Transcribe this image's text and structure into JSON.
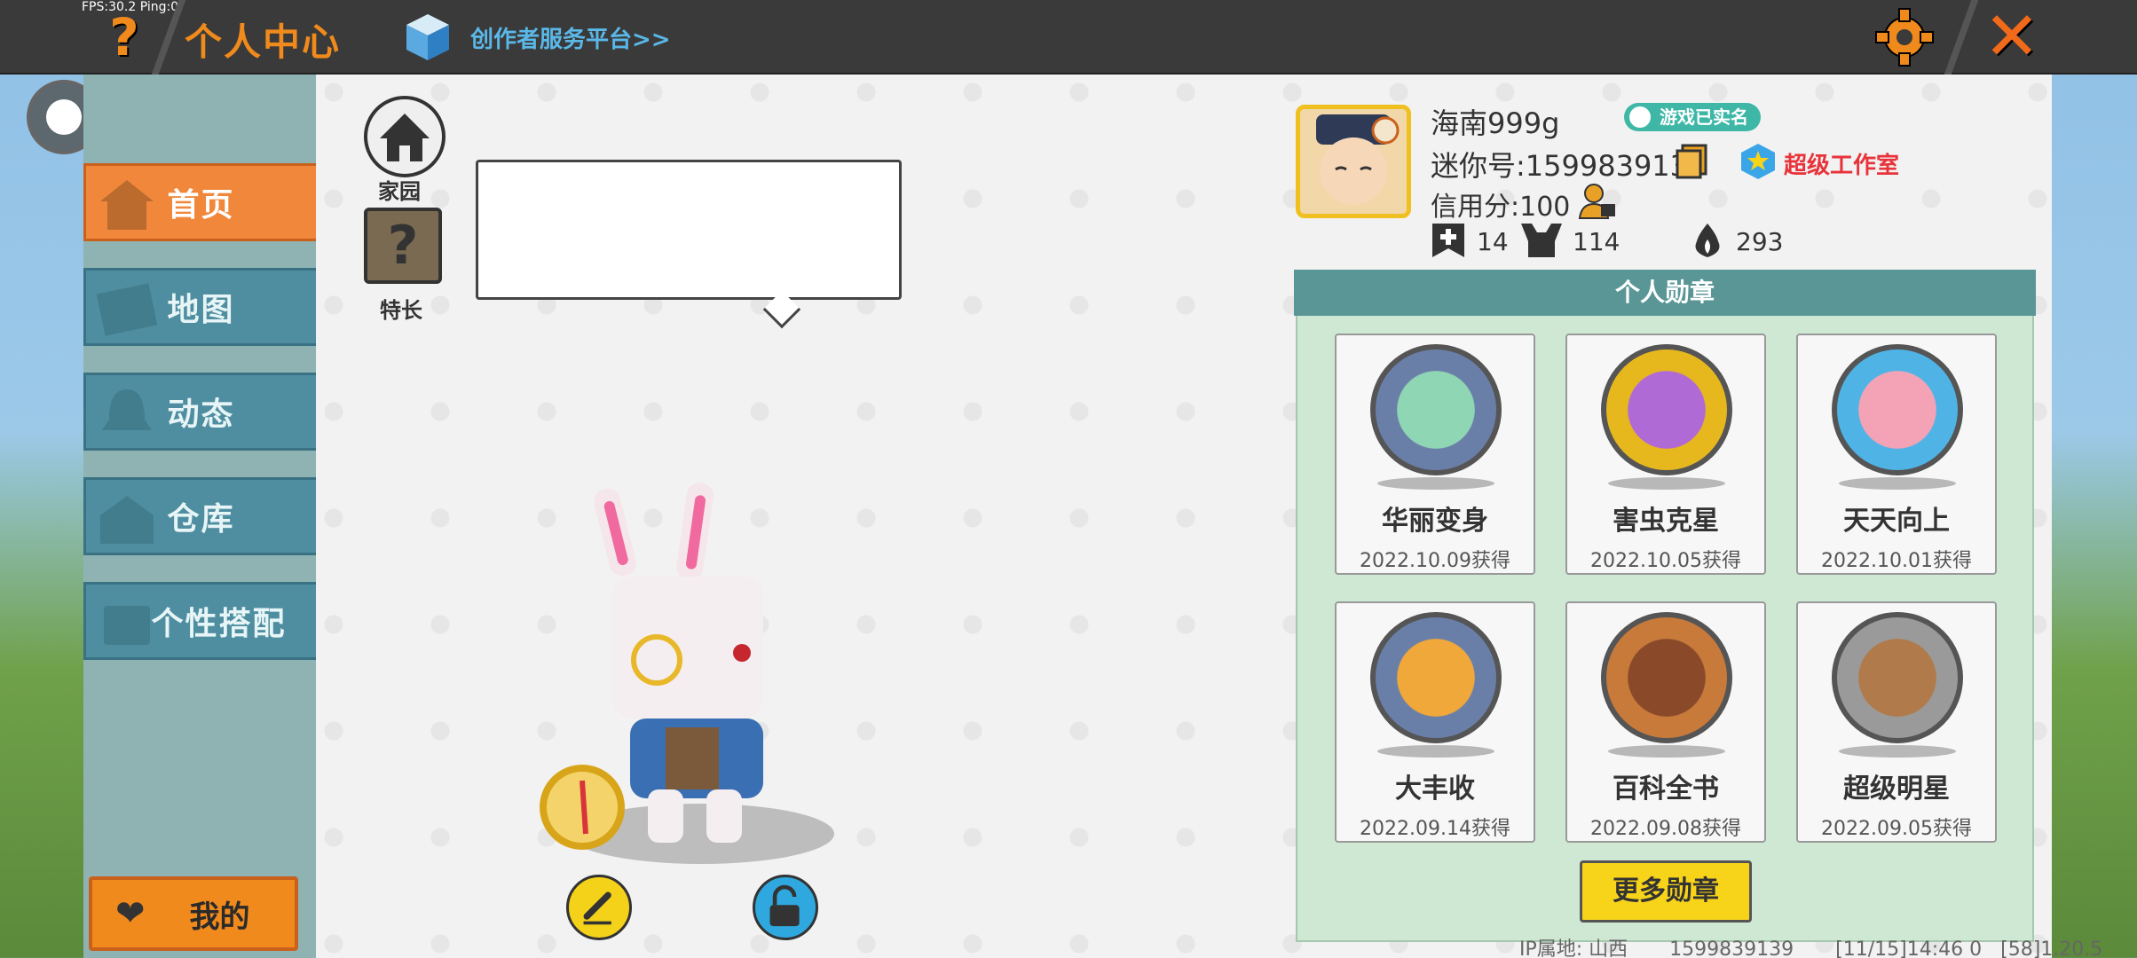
{
  "debug": {
    "fps": "FPS:30.2  Ping:0"
  },
  "header": {
    "title": "个人中心",
    "creator_link": "创作者服务平台>>",
    "help_icon": "question-icon",
    "settings_icon": "gear-icon",
    "close_icon": "close-icon"
  },
  "sidebar": {
    "items": [
      {
        "label": "首页",
        "icon": "house-icon",
        "active": true
      },
      {
        "label": "地图",
        "icon": "map-icon",
        "active": false
      },
      {
        "label": "动态",
        "icon": "bell-icon",
        "active": false
      },
      {
        "label": "仓库",
        "icon": "warehouse-icon",
        "active": false
      },
      {
        "label": "个性搭配",
        "icon": "outfit-icon",
        "active": false
      }
    ],
    "mine_button": "我的"
  },
  "character": {
    "home_label": "家园",
    "talent_label": "特长",
    "speech_text": ""
  },
  "profile": {
    "nickname": "海南999g",
    "verified_badge": "游戏已实名",
    "mini_id": "迷你号:1599839139",
    "studio_link": "超级工作室",
    "credit": "信用分:100",
    "stats": [
      {
        "icon": "bookmark-plus-icon",
        "value": "14"
      },
      {
        "icon": "fans-icon",
        "value": "114"
      },
      {
        "icon": "flame-icon",
        "value": "293"
      }
    ]
  },
  "badges": {
    "header": "个人勋章",
    "items": [
      {
        "name": "华丽变身",
        "date": "2022.10.09获得",
        "color": "#6a7fa8"
      },
      {
        "name": "害虫克星",
        "date": "2022.10.05获得",
        "color": "#e6b81e"
      },
      {
        "name": "天天向上",
        "date": "2022.10.01获得",
        "color": "#4fb3e6"
      },
      {
        "name": "大丰收",
        "date": "2022.09.14获得",
        "color": "#6a7fa8"
      },
      {
        "name": "百科全书",
        "date": "2022.09.08获得",
        "color": "#c77a3a"
      },
      {
        "name": "超级明星",
        "date": "2022.09.05获得",
        "color": "#9a9a9a"
      }
    ],
    "more_button": "更多勋章"
  },
  "footer": {
    "ip": "IP属地: 山西",
    "uid": "1599839139",
    "time": "[11/15]14:46 0",
    "version": "[58]1.20.5"
  },
  "colors": {
    "accent_orange": "#f08a1c",
    "nav_teal": "#4e8ea0",
    "badge_panel": "#cfe8d4",
    "studio_red": "#e8333a"
  }
}
